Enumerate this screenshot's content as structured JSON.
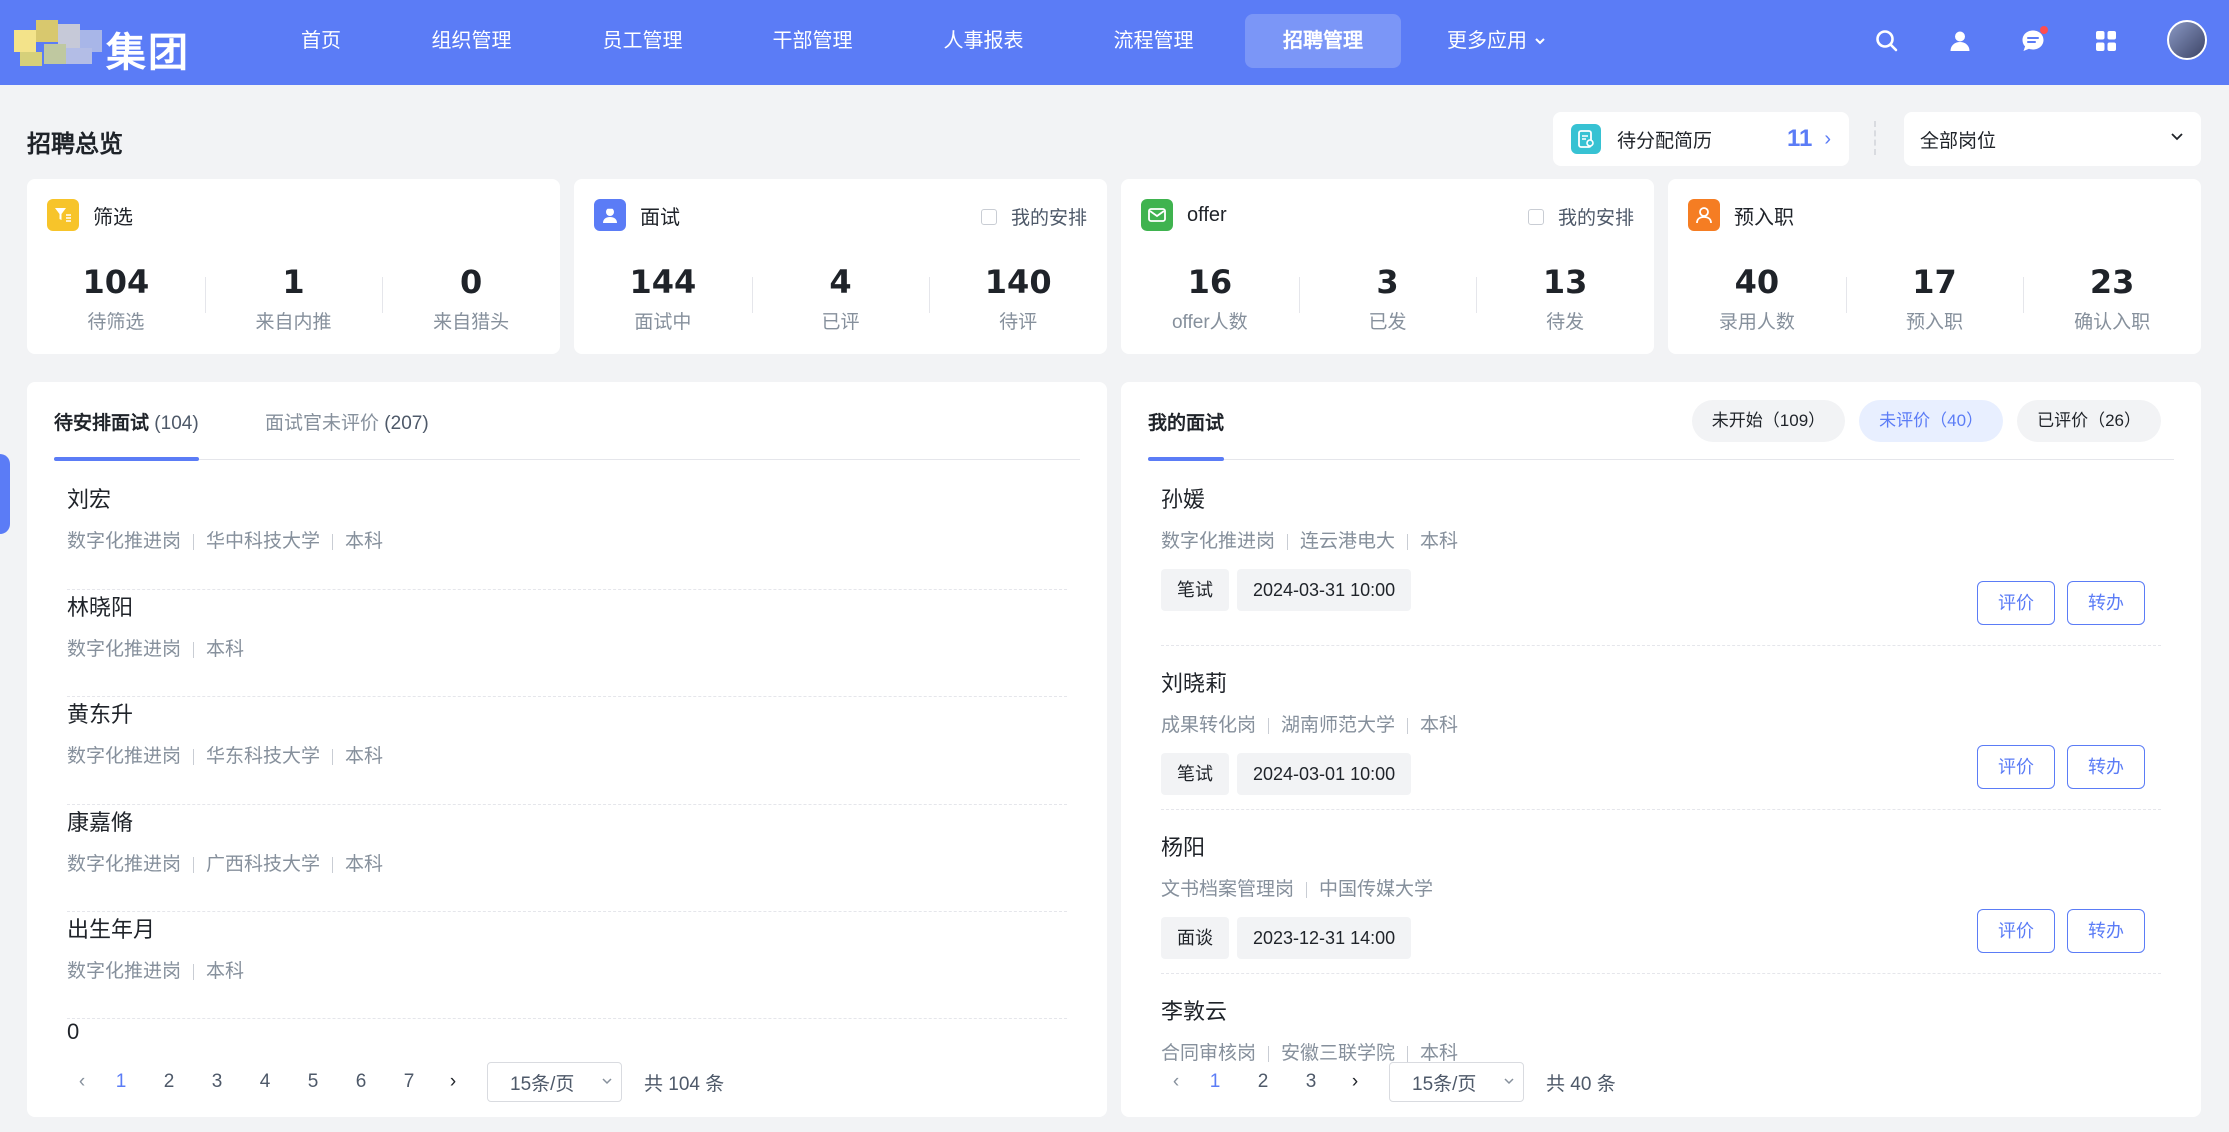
{
  "brand": {
    "name": "集团"
  },
  "nav": {
    "items": [
      {
        "label": "首页",
        "active": false
      },
      {
        "label": "组织管理",
        "active": false
      },
      {
        "label": "员工管理",
        "active": false
      },
      {
        "label": "干部管理",
        "active": false
      },
      {
        "label": "人事报表",
        "active": false
      },
      {
        "label": "流程管理",
        "active": false
      },
      {
        "label": "招聘管理",
        "active": true
      },
      {
        "label": "更多应用",
        "active": false
      }
    ],
    "more_chevron": "⌄",
    "icons": [
      "search-icon",
      "user-icon",
      "message-icon",
      "apps-icon"
    ],
    "accent": "#5b7cf6"
  },
  "header": {
    "title": "招聘总览",
    "pending": {
      "label": "待分配简历",
      "count": "11",
      "arrow": "›"
    },
    "position_select": {
      "value": "全部岗位",
      "chevron": "⌄"
    }
  },
  "stats": [
    {
      "title": "筛选",
      "icon": "filter-icon",
      "color": "#f7c42a",
      "mine": "",
      "items": [
        {
          "value": "104",
          "label": "待筛选"
        },
        {
          "value": "1",
          "label": "来自内推"
        },
        {
          "value": "0",
          "label": "来自猎头"
        }
      ]
    },
    {
      "title": "面试",
      "icon": "interview-icon",
      "color": "#5b7cf6",
      "mine": "我的安排",
      "items": [
        {
          "value": "144",
          "label": "面试中"
        },
        {
          "value": "4",
          "label": "已评"
        },
        {
          "value": "140",
          "label": "待评"
        }
      ]
    },
    {
      "title": "offer",
      "icon": "mail-icon",
      "color": "#3fb34f",
      "mine": "我的安排",
      "items": [
        {
          "value": "16",
          "label": "offer人数"
        },
        {
          "value": "3",
          "label": "已发"
        },
        {
          "value": "13",
          "label": "待发"
        }
      ]
    },
    {
      "title": "预入职",
      "icon": "person-icon",
      "color": "#f57d23",
      "mine": "",
      "items": [
        {
          "value": "40",
          "label": "录用人数"
        },
        {
          "value": "17",
          "label": "预入职"
        },
        {
          "value": "23",
          "label": "确认入职"
        }
      ]
    }
  ],
  "left": {
    "tabs": [
      {
        "label": "待安排面试",
        "count": "(104)",
        "active": true
      },
      {
        "label": "面试官未评价",
        "count": "(207)",
        "active": false
      }
    ],
    "candidates": [
      {
        "name": "刘宏",
        "meta": [
          "数字化推进岗",
          "华中科技大学",
          "本科"
        ]
      },
      {
        "name": "林晓阳",
        "meta": [
          "数字化推进岗",
          "本科"
        ]
      },
      {
        "name": "黄东升",
        "meta": [
          "数字化推进岗",
          "华东科技大学",
          "本科"
        ]
      },
      {
        "name": "康嘉脩",
        "meta": [
          "数字化推进岗",
          "广西科技大学",
          "本科"
        ]
      },
      {
        "name": "出生年月",
        "meta": [
          "数字化推进岗",
          "本科"
        ]
      },
      {
        "name": "0",
        "meta": []
      }
    ],
    "pager": {
      "prev": "‹",
      "next": "›",
      "pages": [
        "1",
        "2",
        "3",
        "4",
        "5",
        "6",
        "7"
      ],
      "current": "1",
      "size": "15条/页",
      "total": "共 104 条"
    }
  },
  "right": {
    "tab": {
      "label": "我的面试"
    },
    "filters": [
      {
        "label": "未开始（109）",
        "active": false
      },
      {
        "label": "未评价（40）",
        "active": true
      },
      {
        "label": "已评价（26）",
        "active": false
      }
    ],
    "interviews": [
      {
        "name": "孙媛",
        "meta": [
          "数字化推进岗",
          "连云港电大",
          "本科"
        ],
        "type": "笔试",
        "time": "2024-03-31 10:00"
      },
      {
        "name": "刘晓莉",
        "meta": [
          "成果转化岗",
          "湖南师范大学",
          "本科"
        ],
        "type": "笔试",
        "time": "2024-03-01 10:00"
      },
      {
        "name": "杨阳",
        "meta": [
          "文书档案管理岗",
          "中国传媒大学"
        ],
        "type": "面谈",
        "time": "2023-12-31 14:00"
      },
      {
        "name": "李敦云",
        "meta": [
          "合同审核岗",
          "安徽三联学院",
          "本科"
        ],
        "type": "",
        "time": ""
      }
    ],
    "actions": {
      "evaluate": "评价",
      "transfer": "转办"
    },
    "pager": {
      "prev": "‹",
      "next": "›",
      "pages": [
        "1",
        "2",
        "3"
      ],
      "current": "1",
      "size": "15条/页",
      "total": "共 40 条"
    }
  }
}
